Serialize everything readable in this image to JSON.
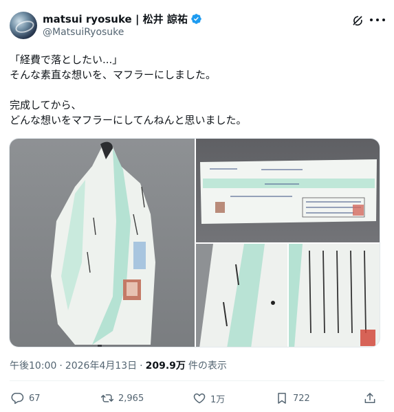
{
  "author": {
    "display_name": "matsui ryosuke | 松井 諒祐",
    "handle": "@MatsuiRyosuke",
    "verified": true,
    "verified_color": "#1d9bf0"
  },
  "tweet": {
    "lines_1": [
      "「経費で落としたい...」",
      "そんな素直な想いを、マフラーにしました。"
    ],
    "lines_2": [
      "完成してから、",
      "どんな想いをマフラーにしてんねんと思いました。"
    ]
  },
  "meta": {
    "time": "午後10:00",
    "separator": "·",
    "date": "2026年4月13日",
    "views_count": "209.9万",
    "views_label": "件の表示"
  },
  "actions": {
    "reply_count": "67",
    "repost_count": "2,965",
    "like_count": "1万",
    "bookmark_count": "722"
  },
  "icons": [
    "verified-badge-icon",
    "grok-icon",
    "more-icon",
    "reply-icon",
    "repost-icon",
    "like-icon",
    "bookmark-icon",
    "share-icon"
  ],
  "colors": {
    "text": "#0f1419",
    "secondary": "#536471",
    "accent": "#1d9bf0",
    "scarf_green": "#a8dccb"
  }
}
